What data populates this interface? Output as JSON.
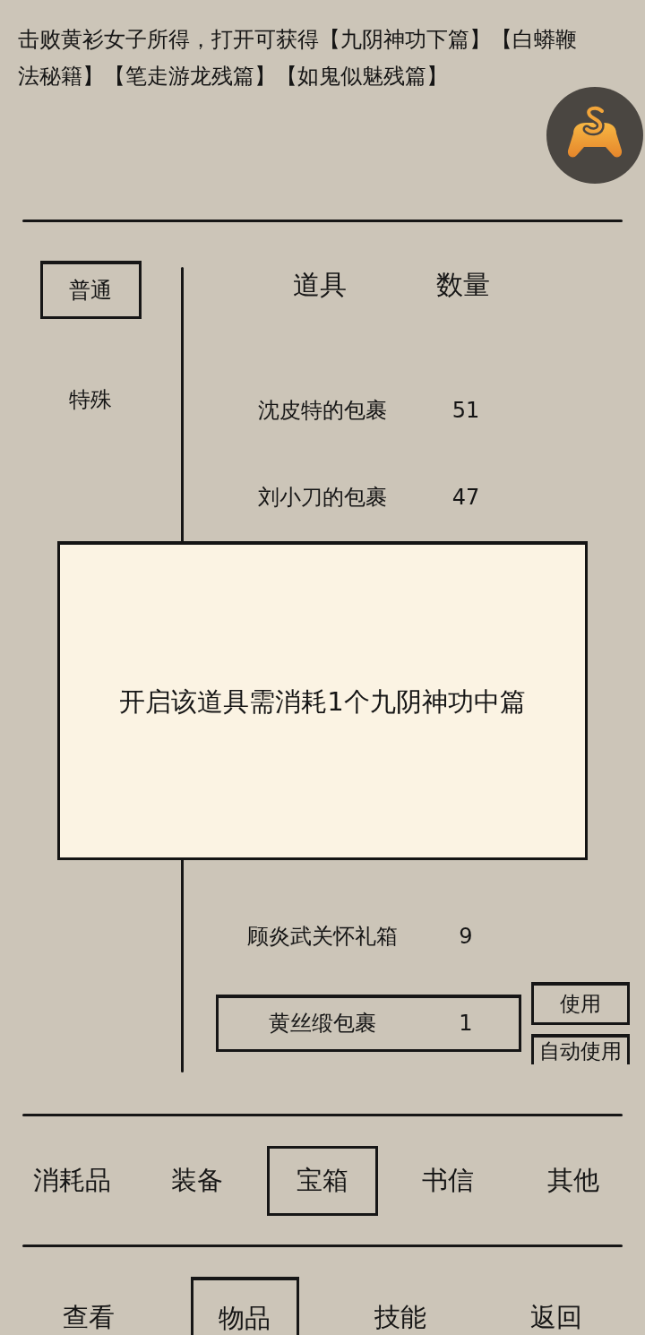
{
  "description": "击败黄衫女子所得，打开可获得【九阴神功下篇】【白蟒鞭法秘籍】【笔走游龙残篇】【如鬼似魅残篇】",
  "side_tabs": [
    {
      "label": "普通",
      "selected": true
    },
    {
      "label": "特殊",
      "selected": false
    }
  ],
  "table": {
    "columns": [
      "道具",
      "数量"
    ],
    "rows": [
      {
        "name": "沈皮特的包裹",
        "count": "51",
        "selected": false
      },
      {
        "name": "刘小刀的包裹",
        "count": "47",
        "selected": false
      },
      {
        "name": "顾炎武关怀礼箱",
        "count": "9",
        "selected": false
      },
      {
        "name": "黄丝缎包裹",
        "count": "1",
        "selected": true
      }
    ]
  },
  "item_actions": [
    "使用",
    "自动使用"
  ],
  "dialog": {
    "message": "开启该道具需消耗1个九阴神功中篇"
  },
  "category_tabs": [
    {
      "label": "消耗品",
      "selected": false
    },
    {
      "label": "装备",
      "selected": false
    },
    {
      "label": "宝箱",
      "selected": true
    },
    {
      "label": "书信",
      "selected": false
    },
    {
      "label": "其他",
      "selected": false
    }
  ],
  "bottom_nav": [
    {
      "label": "查看",
      "selected": false
    },
    {
      "label": "物品",
      "selected": true
    },
    {
      "label": "技能",
      "selected": false
    },
    {
      "label": "返回",
      "selected": false
    }
  ]
}
